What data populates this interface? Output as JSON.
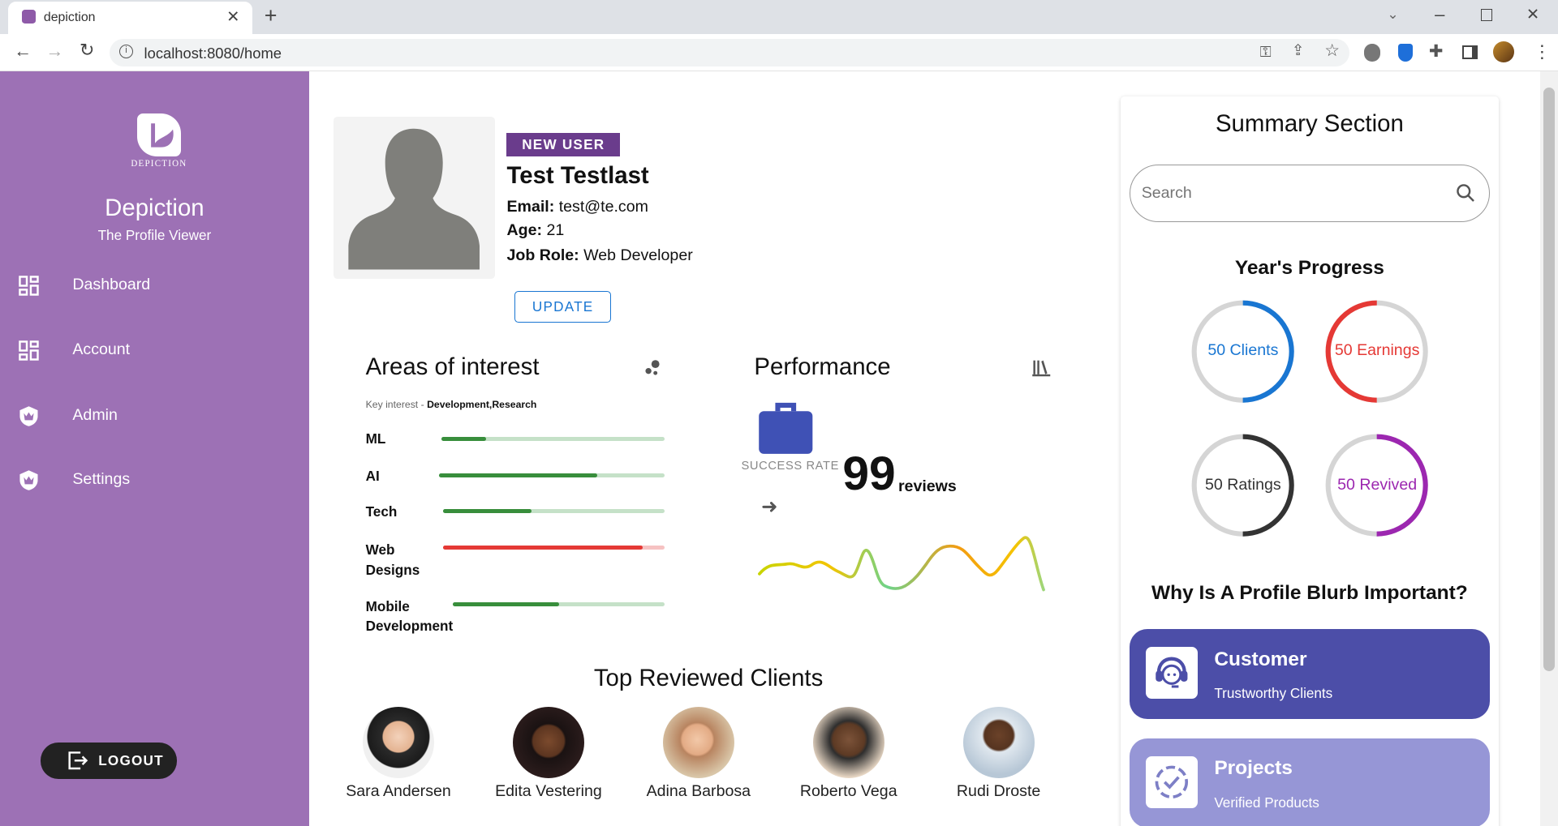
{
  "browser": {
    "tab_title": "depiction",
    "url": "localhost:8080/home"
  },
  "sidebar": {
    "logo_text": "DEPICTION",
    "app_name": "Depiction",
    "tagline": "The Profile Viewer",
    "items": [
      {
        "label": "Dashboard",
        "icon": "dashboard-icon"
      },
      {
        "label": "Account",
        "icon": "dashboard-icon"
      },
      {
        "label": "Admin",
        "icon": "shield-crown-icon"
      },
      {
        "label": "Settings",
        "icon": "shield-crown-icon"
      }
    ],
    "logout_label": "LOGOUT"
  },
  "profile": {
    "badge": "NEW USER",
    "name": "Test Testlast",
    "email_label": "Email:",
    "email": "test@te.com",
    "age_label": "Age:",
    "age": "21",
    "role_label": "Job Role:",
    "role": "Web Developer",
    "update_label": "UPDATE"
  },
  "interests": {
    "title": "Areas of interest",
    "key_label": "Key interest -",
    "key_value": "Development,Research",
    "items": [
      {
        "label": "ML",
        "value": 0.2,
        "color": "#388e3c",
        "bg": "#c5e1c8"
      },
      {
        "label": "AI",
        "value": 0.7,
        "color": "#388e3c",
        "bg": "#c5e1c8"
      },
      {
        "label": "Tech",
        "value": 0.4,
        "color": "#388e3c",
        "bg": "#c5e1c8"
      },
      {
        "label": "Web Designs",
        "value": 0.9,
        "color": "#e53935",
        "bg": "#f6c2c2"
      },
      {
        "label": "Mobile Development",
        "value": 0.5,
        "color": "#388e3c",
        "bg": "#c5e1c8"
      }
    ]
  },
  "performance": {
    "title": "Performance",
    "success_label": "SUCCESS RATE",
    "reviews_number": "99",
    "reviews_label": "reviews"
  },
  "clients": {
    "title": "Top Reviewed Clients",
    "list": [
      {
        "name": "Sara Andersen"
      },
      {
        "name": "Edita Vestering"
      },
      {
        "name": "Adina Barbosa"
      },
      {
        "name": "Roberto Vega"
      },
      {
        "name": "Rudi Droste"
      }
    ]
  },
  "summary": {
    "title": "Summary Section",
    "search_placeholder": "Search",
    "progress_title": "Year's Progress",
    "rings": [
      {
        "label": "50 Clients",
        "value": 0.5,
        "color": "#1976d2",
        "text_color": "#1976d2"
      },
      {
        "label": "50 Earnings",
        "value": 0.5,
        "color": "#e53935",
        "text_color": "#e53935"
      },
      {
        "label": "50 Ratings",
        "value": 0.5,
        "color": "#333333",
        "text_color": "#333333"
      },
      {
        "label": "50 Revived",
        "value": 0.5,
        "color": "#9c27b0",
        "text_color": "#9c27b0"
      }
    ],
    "blurb_title": "Why Is A Profile Blurb Important?",
    "cards": [
      {
        "title": "Customer",
        "subtitle": "Trustworthy Clients",
        "color": "#4c4ea8"
      },
      {
        "title": "Projects",
        "subtitle": "Verified Products",
        "color": "#9696d6"
      }
    ]
  }
}
